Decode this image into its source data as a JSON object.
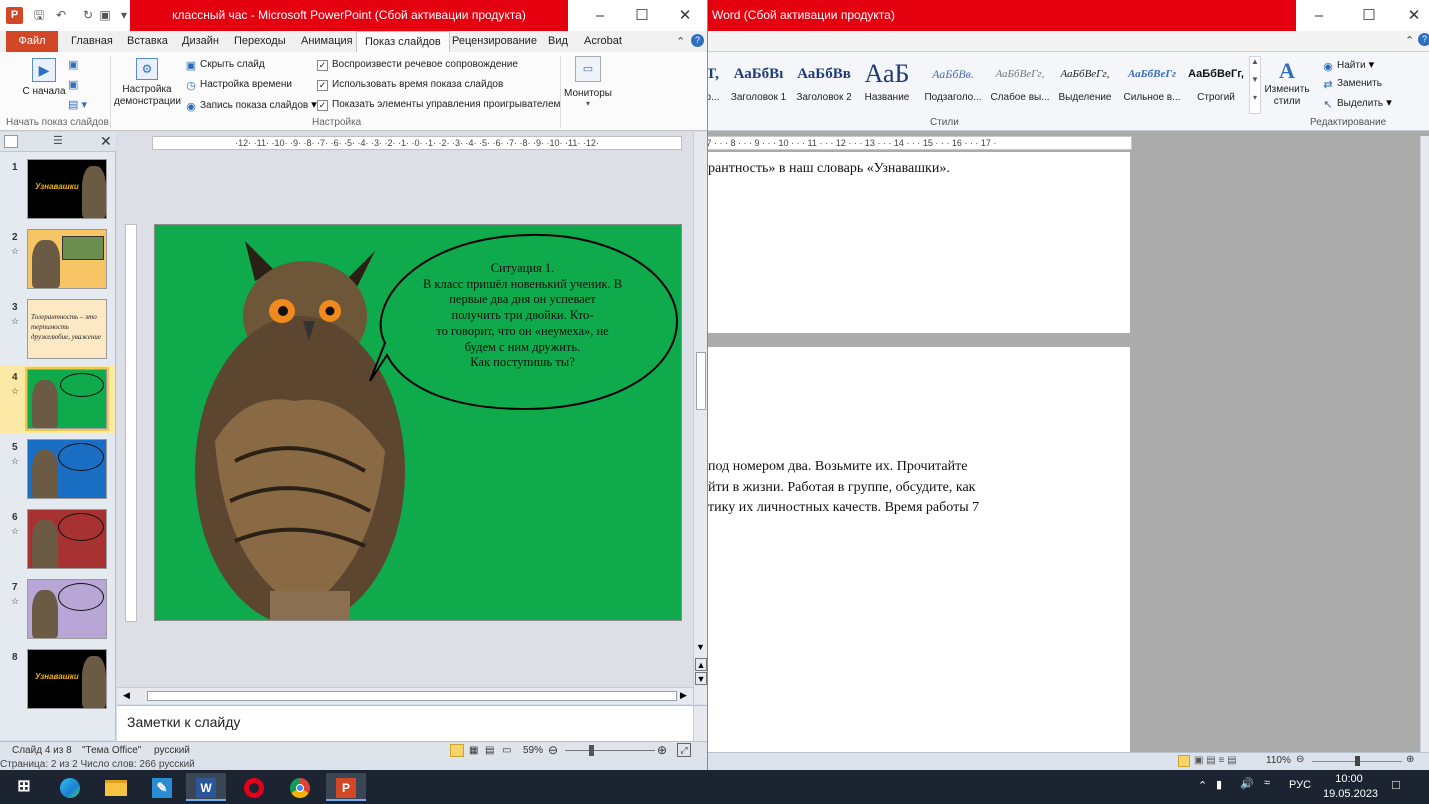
{
  "word": {
    "title": "Word (Сбой активации продукта)",
    "styles": [
      {
        "preview": "T,",
        "name": "р..."
      },
      {
        "preview": "АаБбВı",
        "name": "Заголовок 1"
      },
      {
        "preview": "АаБбВв",
        "name": "Заголовок 2"
      },
      {
        "preview": "АаБ",
        "name": "Название"
      },
      {
        "preview": "АаБбВв.",
        "name": "Подзаголо..."
      },
      {
        "preview": "АаБбВеГг,",
        "name": "Слабое вы..."
      },
      {
        "preview": "АаБбВеГг,",
        "name": "Выделение"
      },
      {
        "preview": "АаБбВеГг",
        "name": "Сильное в..."
      },
      {
        "preview": "АаБбВеГг,",
        "name": "Строгий"
      }
    ],
    "change_styles": "Изменить стили",
    "editing": {
      "find": "Найти",
      "replace": "Заменить",
      "select": "Выделить"
    },
    "group_styles": "Стили",
    "group_editing": "Редактирование",
    "ruler": "· 7 · · · 8 · · · 9 · · · 10 · · · 11 · · · 12 · · · 13 · · · 14 · · · 15 · · · 16 · · · 17 ·",
    "page1_line": "рантность» в наш словарь «Узнавашки».",
    "page2_lines": [
      "под номером два. Возьмите их. Прочитайте",
      "йти в жизни. Работая в группе, обсудите, как",
      "тику их личностных качеств. Время работы 7"
    ],
    "status_left": "Страница: 2 из 2  Число слов: 266  русский",
    "zoom": "110%"
  },
  "ppt": {
    "title": "классный час - Microsoft PowerPoint (Сбой активации продукта)",
    "tabs": [
      "Файл",
      "Главная",
      "Вставка",
      "Дизайн",
      "Переходы",
      "Анимация",
      "Показ слайдов",
      "Рецензирование",
      "Вид",
      "Acrobat"
    ],
    "ribbon": {
      "from_start": "С начала",
      "setup_show": "Настройка демонстрации",
      "hide_slide": "Скрыть слайд",
      "rehearse": "Настройка времени",
      "record": "Запись показа слайдов",
      "play_narrations": "Воспроизвести речевое сопровождение",
      "use_timings": "Использовать время показа слайдов",
      "show_controls": "Показать элементы управления проигрывателем",
      "monitors": "Мониторы",
      "group_start": "Начать показ слайдов",
      "group_setup": "Настройка"
    },
    "hruler": "·12· ·11· ·10· ·9· ·8· ·7· ·6· ·5· ·4· ·3· ·2· ·1· ·0· ·1· ·2· ·3· ·4· ·5· ·6· ·7· ·8· ·9· ·10· ·11· ·12·",
    "slide": {
      "bubble_lines": [
        "Ситуация 1.",
        "В класс пришёл новенький ученик. В",
        "первые два дня он успевает",
        "получить три двойки. Кто-",
        "то говорит, что он «неумеха», не",
        "будем с ним дружить.",
        "Как поступишь ты?"
      ]
    },
    "thumbnails": [
      {
        "num": "1",
        "caption": "Узнавашки"
      },
      {
        "num": "2",
        "caption": ""
      },
      {
        "num": "3",
        "caption": "Толерантность – это терпимость дружелюбие, уважение"
      },
      {
        "num": "4",
        "caption": ""
      },
      {
        "num": "5",
        "caption": ""
      },
      {
        "num": "6",
        "caption": ""
      },
      {
        "num": "7",
        "caption": ""
      },
      {
        "num": "8",
        "caption": "Узнавашки"
      }
    ],
    "notes_placeholder": "Заметки к слайду",
    "status": {
      "slide": "Слайд 4 из 8",
      "theme": "\"Тема Office\"",
      "lang": "русский",
      "zoom": "59%"
    }
  },
  "taskbar": {
    "lang": "РУС",
    "time": "10:00",
    "date": "19.05.2023"
  },
  "colors": {
    "title_red": "#e4000f",
    "slide_green": "#0eaa4b",
    "file_tab": "#d24726"
  }
}
